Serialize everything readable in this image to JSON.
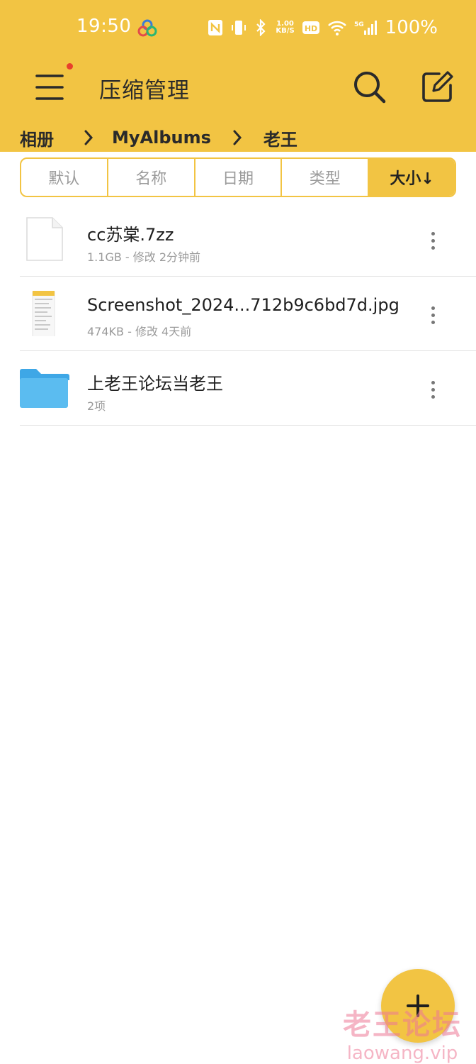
{
  "status_bar": {
    "time": "19:50",
    "net_speed_value": "1.00",
    "net_speed_unit": "KB/S",
    "hd_label": "HD",
    "network_label": "5G",
    "battery": "100%"
  },
  "app_bar": {
    "title": "压缩管理",
    "has_notification_dot": true
  },
  "breadcrumb": [
    "相册",
    "MyAlbums",
    "老王"
  ],
  "sort_tabs": [
    {
      "label": "默认",
      "active": false
    },
    {
      "label": "名称",
      "active": false
    },
    {
      "label": "日期",
      "active": false
    },
    {
      "label": "类型",
      "active": false
    },
    {
      "label": "大小↓",
      "active": true
    }
  ],
  "files": [
    {
      "name": "cc苏棠.7zz",
      "meta": "1.1GB - 修改 2分钟前",
      "icon": "file-icon"
    },
    {
      "name": "Screenshot_2024...712b9c6bd7d.jpg",
      "meta": "474KB - 修改 4天前",
      "icon": "image-thumbnail-icon"
    },
    {
      "name": "上老王论坛当老王",
      "meta": "2项",
      "icon": "folder-icon"
    }
  ],
  "fab": {
    "icon": "plus-icon"
  },
  "watermark": {
    "text_cn": "老王论坛",
    "text_en": "laowang.vip"
  },
  "colors": {
    "accent": "#f2c443",
    "folder": "#5bbcf0",
    "notification_dot": "#e8402c",
    "watermark": "#ec7896"
  }
}
